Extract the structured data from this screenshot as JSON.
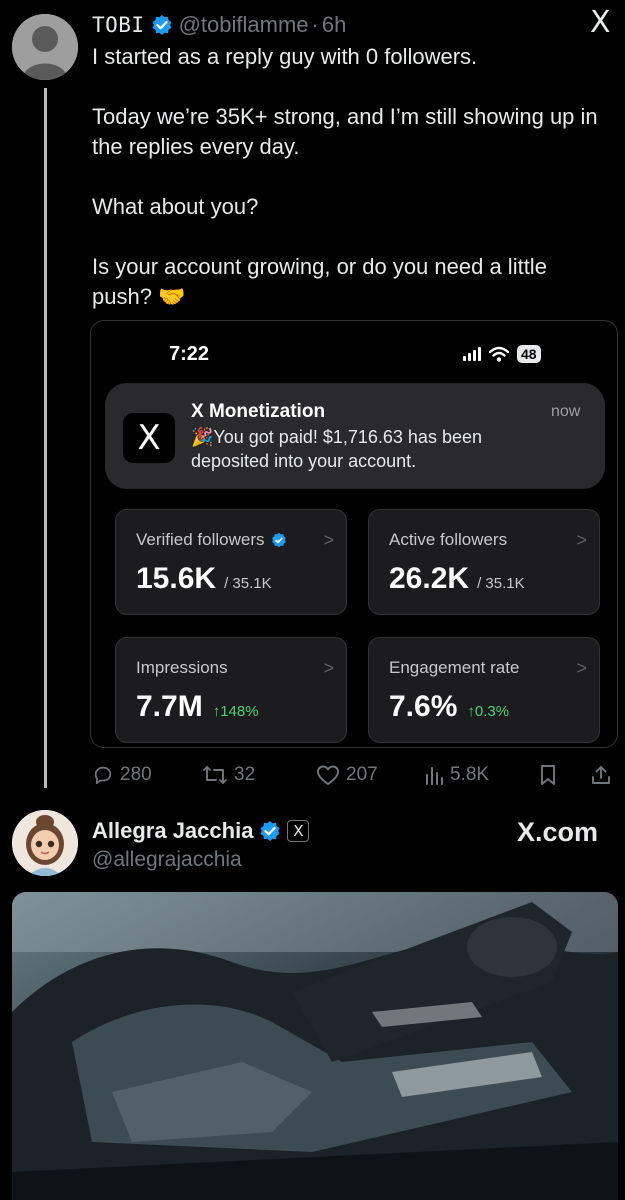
{
  "app_logo": "X",
  "tweet1": {
    "name": "TOBI",
    "handle": "@tobiflamme",
    "separator": "·",
    "time": "6h",
    "paragraphs": [
      "I started as a reply guy with 0 followers.",
      "Today we’re 35K+ strong, and I’m still showing up in the replies every day.",
      "What about you?",
      "Is your account growing, or do you need a little push? 🤝"
    ],
    "card": {
      "status_time": "7:22",
      "battery": "48",
      "notification": {
        "app_icon": "X",
        "title": "X Monetization",
        "time": "now",
        "text": "🎉You got paid! $1,716.63 has been deposited into your account."
      },
      "stats": [
        {
          "label": "Verified followers",
          "value": "15.6K",
          "sub": "/ 35.1K",
          "change": ""
        },
        {
          "label": "Active followers",
          "value": "26.2K",
          "sub": "/ 35.1K",
          "change": ""
        },
        {
          "label": "Impressions",
          "value": "7.7M",
          "sub": "",
          "change": "↑148%"
        },
        {
          "label": "Engagement rate",
          "value": "7.6%",
          "sub": "",
          "change": "↑0.3%"
        }
      ],
      "chevron": ">"
    },
    "actions": {
      "replies": "280",
      "reposts": "32",
      "likes": "207",
      "views": "5.8K"
    }
  },
  "tweet2": {
    "name": "Allegra Jacchia",
    "badge": "X",
    "handle": "@allegrajacchia",
    "brand": "X.com"
  },
  "colors": {
    "background": "#000000",
    "verified": "#1d9bf0",
    "muted": "#71767b",
    "positive": "#4cd07d"
  }
}
